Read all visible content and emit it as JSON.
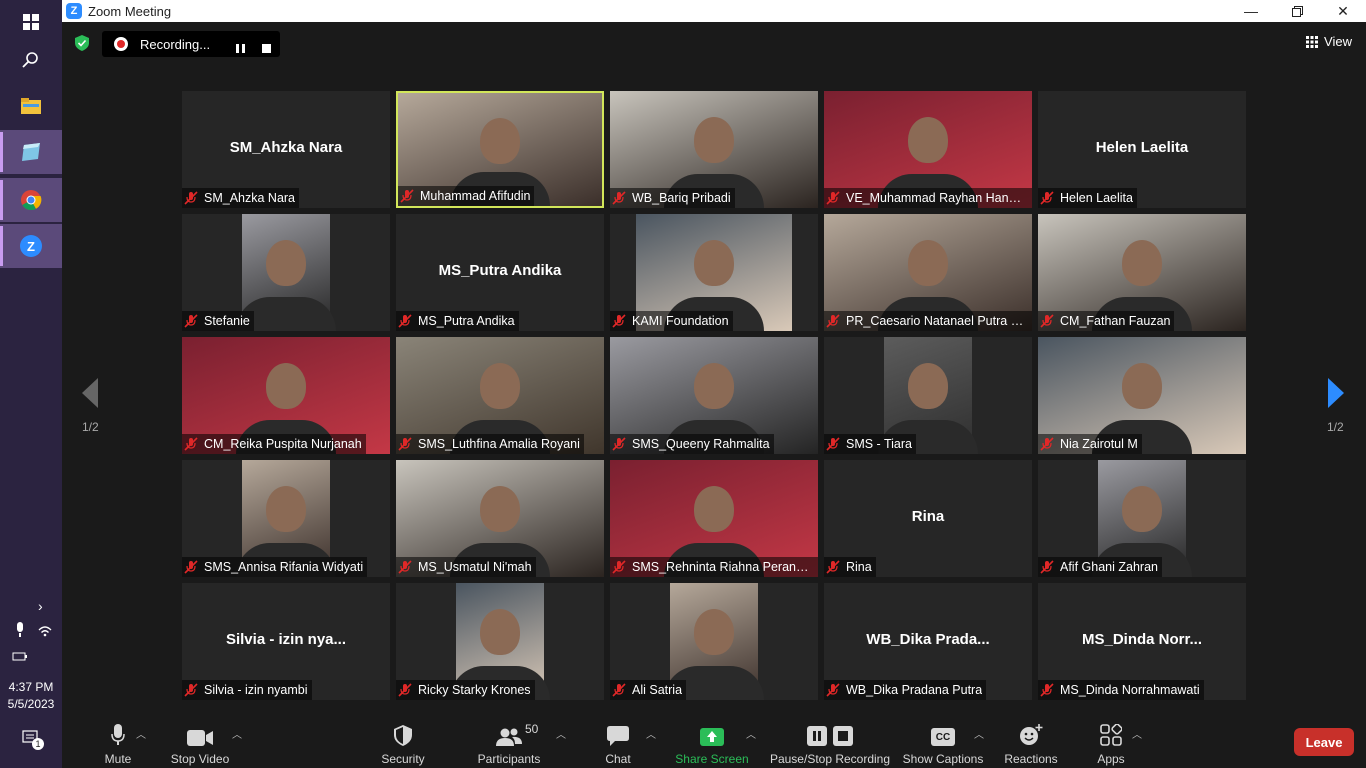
{
  "window": {
    "title": "Zoom Meeting",
    "logo_letter": "Z"
  },
  "taskbar": {
    "time": "4:37 PM",
    "date": "5/5/2023",
    "notification_count": "1"
  },
  "recording": {
    "status": "Recording..."
  },
  "view_button": {
    "label": "View"
  },
  "pagination": {
    "left": "1/2",
    "right": "1/2"
  },
  "tiles": [
    {
      "name": "SM_Ahzka Nara",
      "center_name": "SM_Ahzka Nara",
      "video": false
    },
    {
      "name": "Muhammad Afifudin",
      "video": true,
      "speaking": true
    },
    {
      "name": "WB_Bariq Pribadi",
      "video": true
    },
    {
      "name": "VE_Muhammad Rayhan Hanaf...",
      "video": true
    },
    {
      "name": "Helen Laelita",
      "center_name": "Helen Laelita",
      "video": false
    },
    {
      "name": "Stefanie",
      "video": true
    },
    {
      "name": "MS_Putra Andika",
      "center_name": "MS_Putra Andika",
      "video": false
    },
    {
      "name": "KAMI Foundation",
      "video": true
    },
    {
      "name": "PR_Caesario Natanael Putra R...",
      "video": true
    },
    {
      "name": "CM_Fathan Fauzan",
      "video": true
    },
    {
      "name": "CM_Reika Puspita Nurjanah",
      "video": true
    },
    {
      "name": "SMS_Luthfina Amalia Royani",
      "video": true
    },
    {
      "name": "SMS_Queeny Rahmalita",
      "video": true
    },
    {
      "name": "SMS - Tiara",
      "video": true
    },
    {
      "name": "Nia Zairotul M",
      "video": true
    },
    {
      "name": "SMS_Annisa Rifania Widyati",
      "video": true
    },
    {
      "name": "MS_Usmatul Ni'mah",
      "video": true
    },
    {
      "name": "SMS_Rehninta Riahna Perangi...",
      "video": true
    },
    {
      "name": "Rina",
      "center_name": "Rina",
      "video": false
    },
    {
      "name": "Afif Ghani Zahran",
      "video": true
    },
    {
      "name": "Silvia - izin nyambi",
      "center_name": "Silvia  - izin nya...",
      "video": false
    },
    {
      "name": "Ricky Starky Krones",
      "video": true
    },
    {
      "name": "Ali Satria",
      "video": true
    },
    {
      "name": "WB_Dika Pradana Putra",
      "center_name": "WB_Dika  Prada...",
      "video": false
    },
    {
      "name": "MS_Dinda Norrahmawati",
      "center_name": "MS_Dinda  Norr...",
      "video": false
    }
  ],
  "toolbar": {
    "mute": "Mute",
    "stop_video": "Stop Video",
    "security": "Security",
    "participants": "Participants",
    "participants_count": "50",
    "chat": "Chat",
    "share_screen": "Share Screen",
    "recording": "Pause/Stop Recording",
    "captions": "Show Captions",
    "captions_icon_text": "CC",
    "reactions": "Reactions",
    "apps": "Apps",
    "leave": "Leave"
  },
  "colors": {
    "share_green": "#2bbd58",
    "leave_red": "#c8302a",
    "speaker_border": "#d2e65a",
    "accent_blue": "#2d8cff"
  }
}
